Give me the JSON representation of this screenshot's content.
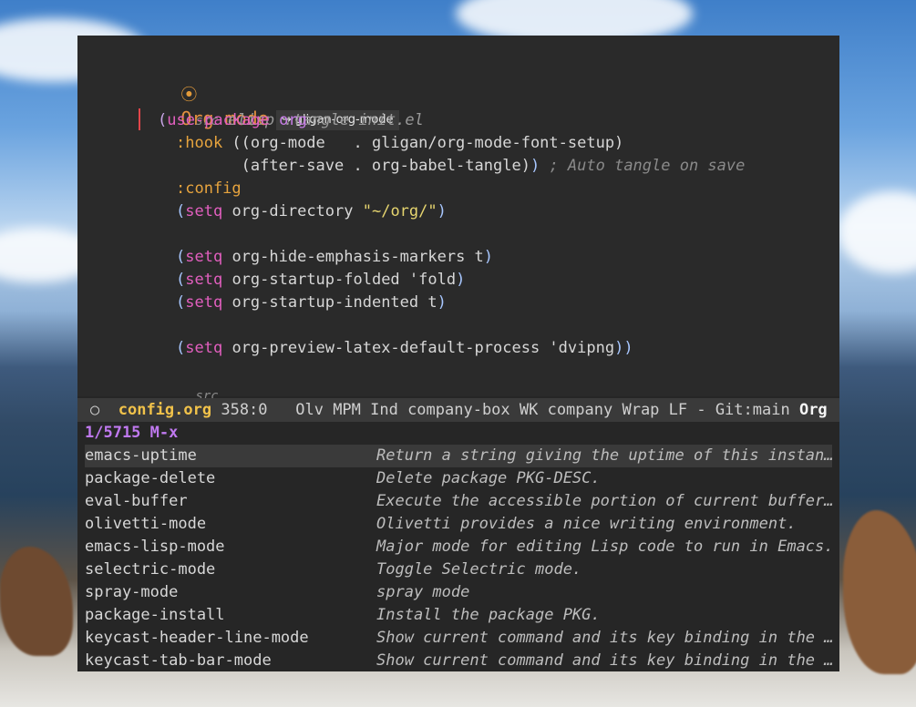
{
  "heading": {
    "bullet": "⦿",
    "title": "Org mode",
    "link_arrow": "↪",
    "link_text": "gligan-org-mode"
  },
  "src_block": {
    "begin_kw": "src",
    "lang_args": "elisp :tangle init.el",
    "end_kw": "src",
    "lines": [
      {
        "id": "l1",
        "tokens": [
          [
            "paren",
            "("
          ],
          [
            "kw",
            "use-package"
          ],
          [
            "plain",
            " "
          ],
          [
            "pkg",
            "org"
          ]
        ]
      },
      {
        "id": "l2",
        "tokens": [
          [
            "key",
            ":hook"
          ],
          [
            "plain",
            " ((org-mode   . gligan/org-mode-font-setup)"
          ]
        ]
      },
      {
        "id": "l3",
        "tokens": [
          [
            "plain",
            "       (after-save . org-babel-tangle)"
          ],
          [
            "paren2",
            ")"
          ],
          [
            "plain",
            " "
          ],
          [
            "comment",
            "; Auto tangle on save"
          ]
        ]
      },
      {
        "id": "l4",
        "tokens": [
          [
            "key",
            ":config"
          ]
        ]
      },
      {
        "id": "l5",
        "tokens": [
          [
            "paren2",
            "("
          ],
          [
            "kw",
            "setq"
          ],
          [
            "plain",
            " org-directory "
          ],
          [
            "str",
            "\"~/org/\""
          ],
          [
            "paren2",
            ")"
          ]
        ]
      },
      {
        "id": "l6",
        "tokens": [
          [
            "paren2",
            "("
          ],
          [
            "kw",
            "setq"
          ],
          [
            "plain",
            " org-hide-emphasis-markers t"
          ],
          [
            "paren2",
            ")"
          ]
        ]
      },
      {
        "id": "l7",
        "tokens": [
          [
            "paren2",
            "("
          ],
          [
            "kw",
            "setq"
          ],
          [
            "plain",
            " org-startup-folded 'fold"
          ],
          [
            "paren2",
            ")"
          ]
        ]
      },
      {
        "id": "l8",
        "tokens": [
          [
            "paren2",
            "("
          ],
          [
            "kw",
            "setq"
          ],
          [
            "plain",
            " org-startup-indented t"
          ],
          [
            "paren2",
            ")"
          ]
        ]
      },
      {
        "id": "l9",
        "tokens": [
          [
            "paren2",
            "("
          ],
          [
            "kw",
            "setq"
          ],
          [
            "plain",
            " org-preview-latex-default-process 'dvipng"
          ],
          [
            "paren2",
            "))"
          ]
        ]
      }
    ]
  },
  "modeline": {
    "indicator": "○",
    "buffer": "config.org",
    "position": "358:0",
    "minor_modes": "Olv MPM Ind company-box WK company Wrap LF - Git:main",
    "major_mode": "Org"
  },
  "minibuffer": {
    "prompt": "1/5715 M-x",
    "candidates": [
      {
        "name": "emacs-uptime",
        "desc": "Return a string giving the uptime of this instan…"
      },
      {
        "name": "package-delete",
        "desc": "Delete package PKG-DESC."
      },
      {
        "name": "eval-buffer",
        "desc": "Execute the accessible portion of current buffer…"
      },
      {
        "name": "olivetti-mode",
        "desc": "Olivetti provides a nice writing environment."
      },
      {
        "name": "emacs-lisp-mode",
        "desc": "Major mode for editing Lisp code to run in Emacs."
      },
      {
        "name": "selectric-mode",
        "desc": "Toggle Selectric mode."
      },
      {
        "name": "spray-mode",
        "desc": "spray mode"
      },
      {
        "name": "package-install",
        "desc": "Install the package PKG."
      },
      {
        "name": "keycast-header-line-mode",
        "desc": "Show current command and its key binding in the …"
      },
      {
        "name": "keycast-tab-bar-mode",
        "desc": "Show current command and its key binding in the …"
      }
    ]
  },
  "colors": {
    "accent_orange": "#e3903f",
    "prompt_purple": "#c079f0",
    "modeline_bg": "#3a3a3a",
    "editor_bg": "#2a2a2a"
  }
}
